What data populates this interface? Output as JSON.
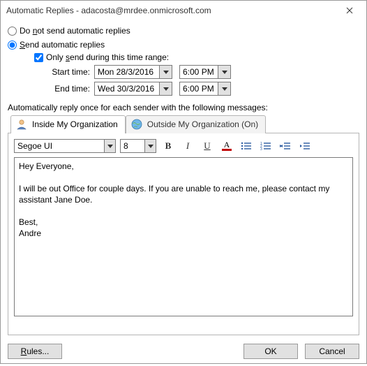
{
  "title": "Automatic Replies - adacosta@mrdee.onmicrosoft.com",
  "radio": {
    "dont_pre": "Do ",
    "dont_u": "n",
    "dont_post": "ot send automatic replies",
    "send_u": "S",
    "send_post": "end automatic replies"
  },
  "only_send": {
    "pre": "Only ",
    "u": "s",
    "post": "end during this time range:"
  },
  "start_label": "Start time:",
  "end_label": "End time:",
  "start_date": "Mon 28/3/2016",
  "end_date": "Wed 30/3/2016",
  "start_time": "6:00 PM",
  "end_time": "6:00 PM",
  "section_label": "Automatically reply once for each sender with the following messages:",
  "tabs": {
    "inside": "Inside My Organization",
    "outside": "Outside My Organization (On)"
  },
  "font_name": "Segoe UI",
  "font_size": "8",
  "body": {
    "greet": "Hey Everyone,",
    "msg": "I will be out Office for couple days. If you are unable to reach me, please contact my assistant Jane Doe.",
    "sign1": "Best,",
    "sign2": "Andre"
  },
  "buttons": {
    "rules_u": "R",
    "rules_post": "ules...",
    "ok": "OK",
    "cancel": "Cancel"
  }
}
